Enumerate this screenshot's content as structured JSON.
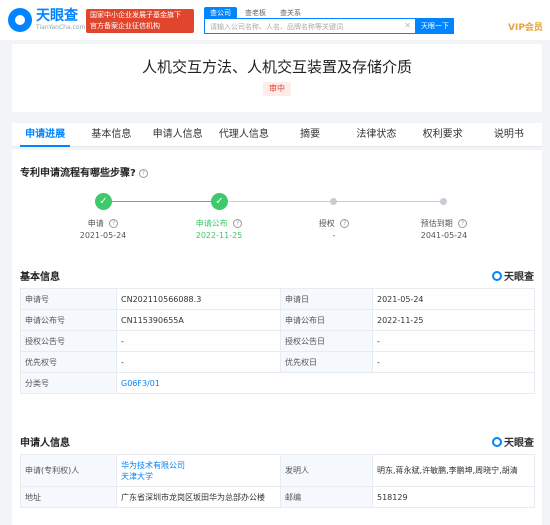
{
  "header": {
    "logo_cn": "天眼查",
    "logo_en": "TianYanCha.com",
    "gov_banner_line1": "国家中小企业发展子基金旗下",
    "gov_banner_line2": "官方备案企业征信机构",
    "search_tabs": [
      "查公司",
      "查老板",
      "查关系"
    ],
    "search_placeholder": "请输入公司名称、人名、品牌名称等关键词",
    "search_button": "天眼一下",
    "vip": "VIP会员"
  },
  "patent": {
    "title": "人机交互方法、人机交互装置及存储介质",
    "status": "审中"
  },
  "tabs": [
    "申请进展",
    "基本信息",
    "申请人信息",
    "代理人信息",
    "摘要",
    "法律状态",
    "权利要求",
    "说明书"
  ],
  "progress": {
    "question": "专利申请流程有哪些步骤?",
    "steps": [
      {
        "label": "申请",
        "date": "2021-05-24"
      },
      {
        "label": "申请公布",
        "date": "2022-11-25"
      },
      {
        "label": "授权",
        "date": "-"
      },
      {
        "label": "预估到期",
        "date": "2041-05-24"
      }
    ]
  },
  "basic": {
    "title": "基本信息",
    "brand": "天眼查",
    "rows": [
      [
        {
          "k": "申请号",
          "v": "CN202110566088.3"
        },
        {
          "k": "申请日",
          "v": "2021-05-24"
        }
      ],
      [
        {
          "k": "申请公布号",
          "v": "CN115390655A"
        },
        {
          "k": "申请公布日",
          "v": "2022-11-25"
        }
      ],
      [
        {
          "k": "授权公告号",
          "v": "-"
        },
        {
          "k": "授权公告日",
          "v": "-"
        }
      ],
      [
        {
          "k": "优先权号",
          "v": "-"
        },
        {
          "k": "优先权日",
          "v": "-"
        }
      ]
    ],
    "class_label": "分类号",
    "class_value": "G06F3/01"
  },
  "applicant": {
    "title": "申请人信息",
    "brand": "天眼查",
    "applicant_label": "申请(专利权)人",
    "applicants": [
      "华为技术有限公司",
      "天津大学"
    ],
    "inventor_label": "发明人",
    "inventors": "明东,蒋永斌,许敏鹏,李鹏坤,周晓宁,胡清",
    "address_label": "地址",
    "address": "广东省深圳市龙岗区坂田华为总部办公楼",
    "zip_label": "邮编",
    "zip": "518129"
  }
}
